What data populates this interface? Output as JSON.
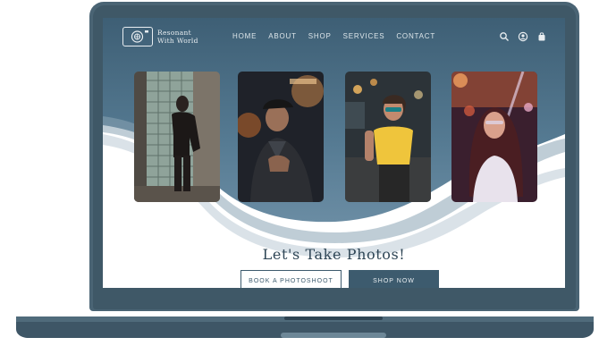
{
  "site": {
    "logo_line1": "Resonant",
    "logo_line2": "With World",
    "logo_icon": "camera-icon"
  },
  "nav": {
    "items": [
      {
        "label": "HOME"
      },
      {
        "label": "ABOUT"
      },
      {
        "label": "SHOP"
      },
      {
        "label": "SERVICES"
      },
      {
        "label": "CONTACT"
      }
    ],
    "icons": [
      "search-icon",
      "user-icon",
      "cart-icon"
    ]
  },
  "hero": {
    "headline": "Let's Take Photos!",
    "book_button": "BOOK A PHOTOSHOOT",
    "shop_button": "SHOP NOW"
  },
  "gallery": [
    {
      "subject": "woman-in-leather-jacket-photo"
    },
    {
      "subject": "man-in-cap-photo"
    },
    {
      "subject": "woman-in-yellow-shirt-photo"
    },
    {
      "subject": "woman-in-neon-light-photo"
    }
  ],
  "colors": {
    "primary": "#3d5b6e",
    "hero_top": "#4d6f85",
    "laptop_body": "#4a6474",
    "text_light": "#e9eef1"
  }
}
